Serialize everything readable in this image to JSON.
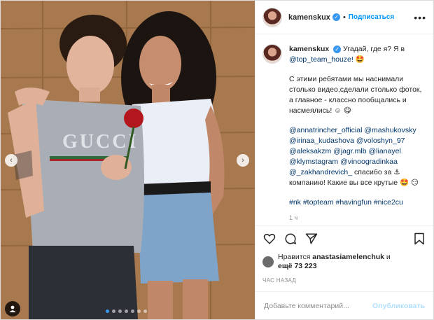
{
  "header": {
    "username": "kamenskux",
    "separator": "•",
    "follow_label": "Подписаться"
  },
  "caption": {
    "username": "kamenskux",
    "line1": "Угадай, где я? Я в",
    "mention1": "@top_team_houze!",
    "emoji1": "🤩",
    "para2": "С этими ребятами мы наснимали столько видео,сделали столько фоток, а главное - классно пообщались и насмеялись! ☺",
    "emoji2": "😋",
    "mentions": "@annatrincher_official @mashukovsky @irinaa_kudashova @voloshyn_97 @aleksakzm @jagr.mlb @lianayel @klymstagram @vinoogradinkaa @_zakhandrevich_",
    "thanks": "спасибо за",
    "emoji3": "⚓",
    "thanks2": "компанию! Какие вы все крутые",
    "emoji4": "🤩",
    "emoji5": "😏",
    "hashtags": "#nk #topteam #havingfun #nice2cu",
    "time": "1 ч"
  },
  "likes": {
    "prefix": "Нравится",
    "user": "anastasiamelenchuk",
    "and": "и",
    "count": "ещё 73 223"
  },
  "posted_ago": "ЧАС НАЗАД",
  "comment": {
    "placeholder": "Добавьте комментарий...",
    "publish_label": "Опубликовать"
  },
  "carousel": {
    "total_slides": 7,
    "active_index": 0
  },
  "photo": {
    "shirt_text": "GUCCI"
  },
  "colors": {
    "accent": "#0095f6",
    "link": "#00376b",
    "active_dot": "#3897f0"
  }
}
